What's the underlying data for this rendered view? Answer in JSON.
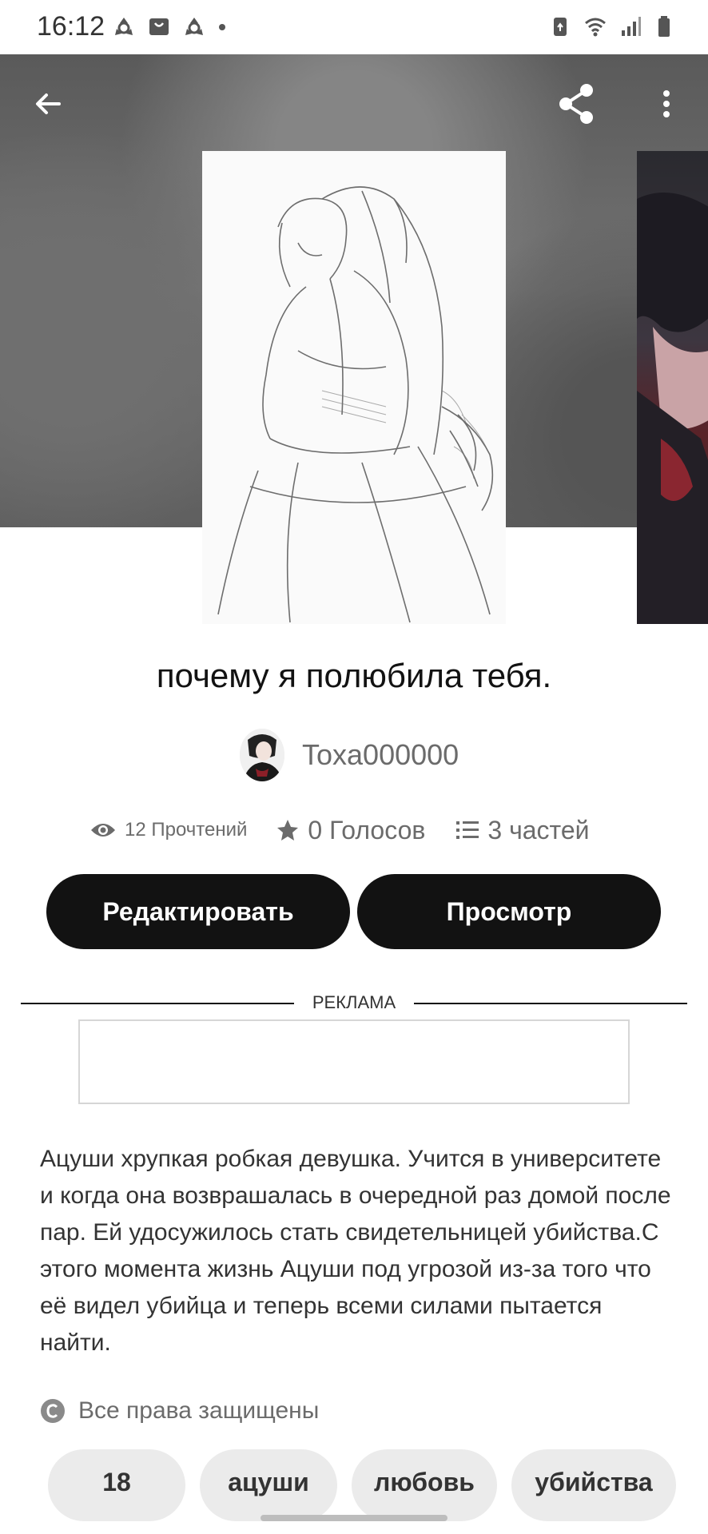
{
  "status_bar": {
    "time": "16:12",
    "left_icons": [
      "recycle-icon",
      "shopping-bag-icon",
      "recycle-icon",
      "dot-icon"
    ],
    "right_icons": [
      "battery-saver-icon",
      "wifi-icon",
      "signal-icon",
      "battery-icon"
    ]
  },
  "header": {
    "back_icon": "arrow-left-icon",
    "share_icon": "share-icon",
    "more_icon": "more-vertical-icon"
  },
  "story": {
    "title": "почему я полюбила тебя.",
    "author": "Toxa000000",
    "stats": {
      "reads": "12 Прочтений",
      "votes": "0 Голосов",
      "parts": "3 частей"
    },
    "description": "Ацуши хрупкая робкая девушка. Учится в университете и когда она возврашалась в очередной раз домой после пар. Ей удосужилось стать свидетельницей убийства.С этого момента жизнь Ацуши под угрозой из-за того что её видел убийца и теперь всеми силами пытается найти.",
    "copyright": "Все права защищены"
  },
  "actions": {
    "edit_label": "Редактировать",
    "view_label": "Просмотр"
  },
  "ad": {
    "label": "РЕКЛАМА"
  },
  "tags": [
    "18",
    "ацуши",
    "любовь",
    "убийства"
  ],
  "colors": {
    "primary": "#121212",
    "muted_text": "#6b6b6b",
    "tag_bg": "#ebebeb"
  }
}
